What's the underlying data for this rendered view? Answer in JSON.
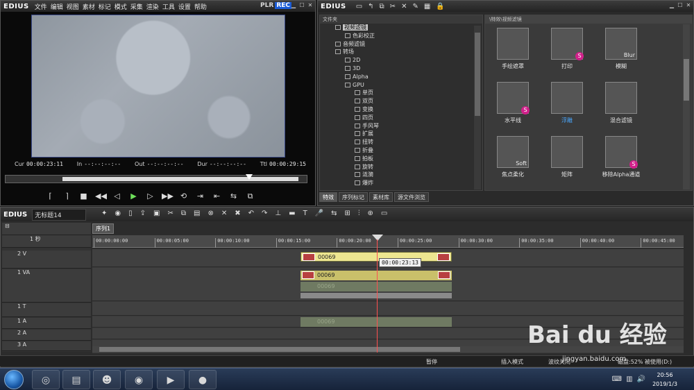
{
  "player": {
    "logo": "EDIUS",
    "menu": [
      "文件",
      "编辑",
      "视图",
      "素材",
      "标记",
      "模式",
      "采集",
      "渲染",
      "工具",
      "设置",
      "帮助"
    ],
    "plr": "PLR",
    "rec": "REC",
    "cur_label": "Cur",
    "cur": "00:00:23:11",
    "in_label": "In",
    "in": "--:--:--:--",
    "out_label": "Out",
    "out": "--:--:--:--",
    "dur_label": "Dur",
    "dur": "--:--:--:--",
    "ttl_label": "Ttl",
    "ttl": "00:00:29:15",
    "scrub_position_fraction": 0.79
  },
  "bin": {
    "logo": "EDIUS",
    "tree_header": "文件夹",
    "tree": [
      {
        "label": "视频滤镜",
        "indent": 1,
        "selected": true
      },
      {
        "label": "色彩校正",
        "indent": 2
      },
      {
        "label": "音频滤镜",
        "indent": 1
      },
      {
        "label": "转场",
        "indent": 1
      },
      {
        "label": "2D",
        "indent": 2
      },
      {
        "label": "3D",
        "indent": 2
      },
      {
        "label": "Alpha",
        "indent": 2
      },
      {
        "label": "GPU",
        "indent": 2
      },
      {
        "label": "单页",
        "indent": 3
      },
      {
        "label": "双页",
        "indent": 3
      },
      {
        "label": "变换",
        "indent": 3
      },
      {
        "label": "四页",
        "indent": 3
      },
      {
        "label": "手风琴",
        "indent": 3
      },
      {
        "label": "扩展",
        "indent": 3
      },
      {
        "label": "扭转",
        "indent": 3
      },
      {
        "label": "折叠",
        "indent": 3
      },
      {
        "label": "拍板",
        "indent": 3
      },
      {
        "label": "旋转",
        "indent": 3
      },
      {
        "label": "涟漪",
        "indent": 3
      },
      {
        "label": "爆炸",
        "indent": 3
      }
    ],
    "grid_path": "\\特效\\视频滤镜",
    "effects": [
      {
        "name": "手绘遮罩",
        "badge": false
      },
      {
        "name": "打印",
        "badge": true
      },
      {
        "name": "模糊",
        "badge": false,
        "thumb_text": "Blur"
      },
      {
        "name": "水平线",
        "badge": true
      },
      {
        "name": "浮雕",
        "badge": false,
        "highlight": true
      },
      {
        "name": "混合滤镜",
        "badge": false
      },
      {
        "name": "焦点柔化",
        "badge": false,
        "thumb_text": "Soft"
      },
      {
        "name": "矩阵",
        "badge": false
      },
      {
        "name": "移除Alpha通道",
        "badge": true
      }
    ],
    "tabs": [
      "特效",
      "序列标记",
      "素材库",
      "源文件浏览"
    ]
  },
  "timeline": {
    "logo": "EDIUS",
    "project_name": "无标题14",
    "sequence_tab": "序列1",
    "scale_label": "1 秒",
    "ruler": [
      "00:00:00:00",
      "00:00:05:00",
      "00:00:10:00",
      "00:00:15:00",
      "00:00:20:00",
      "00:00:25:00",
      "00:00:30:00",
      "00:00:35:00",
      "00:00:40:00",
      "00:00:45:00"
    ],
    "tracks": [
      {
        "name": "2 V"
      },
      {
        "name": "1 VA"
      },
      {
        "name": "1 T"
      },
      {
        "name": "1 A"
      },
      {
        "name": "2 A"
      },
      {
        "name": "3 A"
      }
    ],
    "clip_name": "00069",
    "tooltip": "00:00:23:13"
  },
  "status": {
    "pause": "暂停",
    "mode": "插入模式",
    "ripple": "波纹关闭",
    "disk": "磁盘:52% 被使用(D:)"
  },
  "taskbar": {
    "time": "20:56",
    "date": "2019/1/3"
  },
  "watermark": {
    "brand": "Bai du 经验",
    "url": "jingyan.baidu.com"
  },
  "colors": {
    "rec_badge": "#1a5bd6",
    "play_button": "#6ee05a",
    "playhead": "#ff5050",
    "video_clip": "#ede690",
    "effect_badge": "#d0208a"
  }
}
